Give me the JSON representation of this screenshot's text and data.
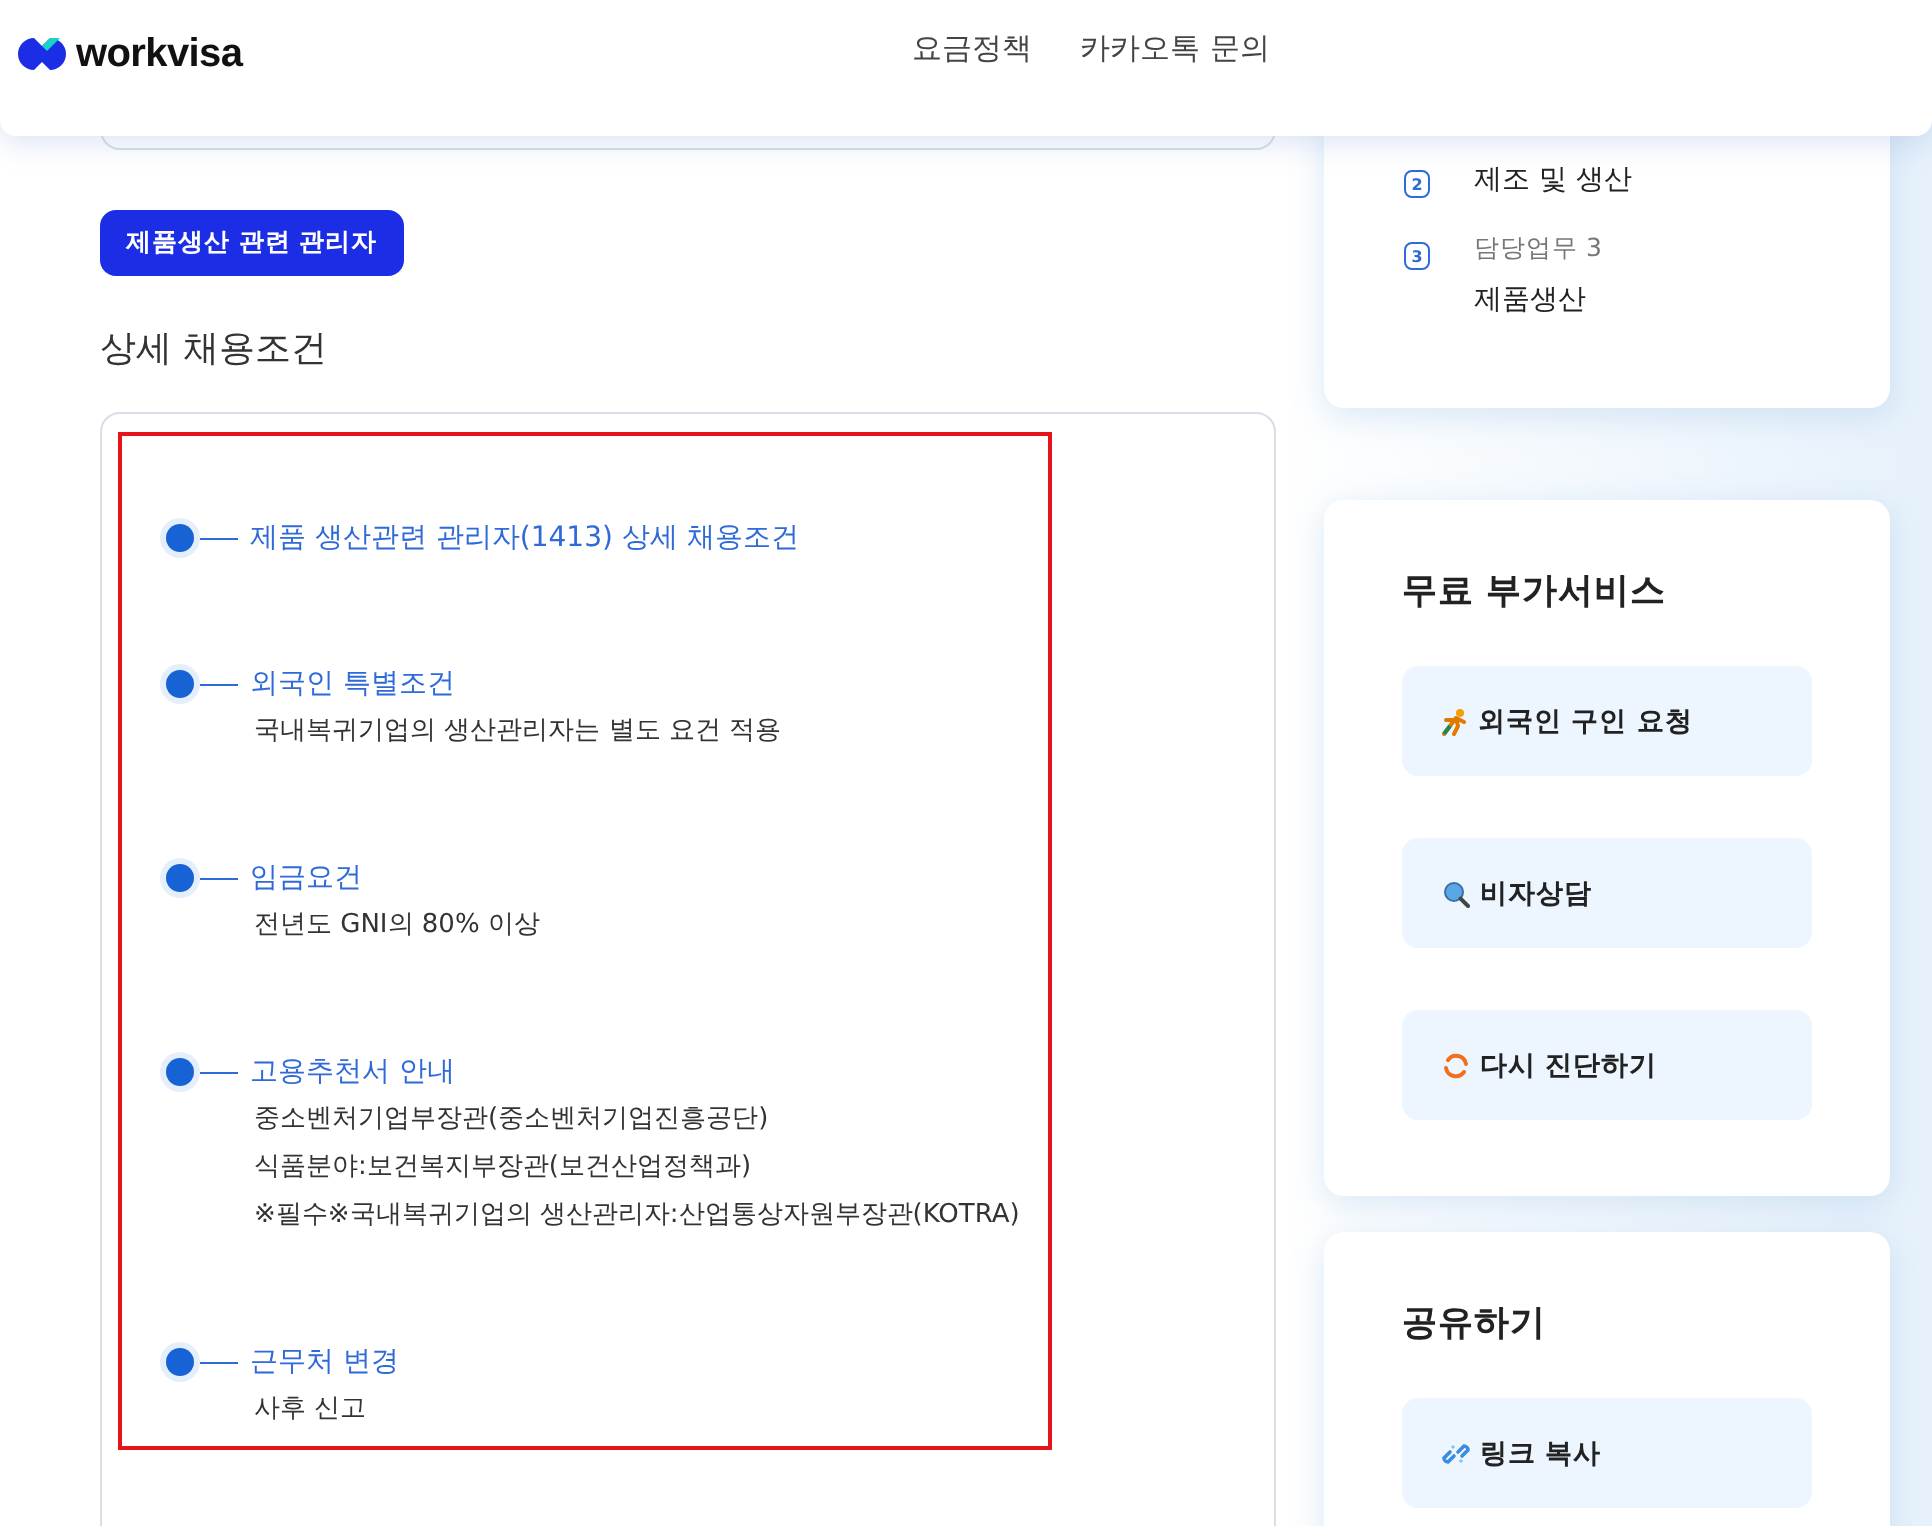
{
  "header": {
    "logo": "workvisa",
    "nav": [
      "요금정책",
      "카카오톡 문의"
    ]
  },
  "job_tag": "제품생산 관련 관리자",
  "section_title": "상세 채용조건",
  "conditions": [
    {
      "title": "제품 생산관련 관리자(1413) 상세 채용조건"
    },
    {
      "title": "외국인 특별조건",
      "lines": [
        "국내복귀기업의 생산관리자는 별도 요건 적용"
      ]
    },
    {
      "title": "임금요건",
      "lines": [
        "전년도 GNI의 80% 이상"
      ]
    },
    {
      "title": "고용추천서 안내",
      "lines": [
        "중소벤처기업부장관(중소벤처기업진흥공단)",
        "식품분야:보건복지부장관(보건산업정책과)",
        "※필수※국내복귀기업의 생산관리자:산업통상자원부장관(KOTRA)"
      ]
    },
    {
      "title": "근무처 변경",
      "lines": [
        "사후 신고"
      ]
    }
  ],
  "duties": [
    {
      "number": "2",
      "value": "제조 및 생산"
    },
    {
      "number": "3",
      "label": "담당업무 3",
      "value": "제품생산"
    }
  ],
  "free_services": {
    "title": "무료 부가서비스",
    "buttons": [
      {
        "kind": "runner",
        "label": "외국인 구인 요청"
      },
      {
        "kind": "search",
        "label": "비자상담"
      },
      {
        "kind": "refresh",
        "label": "다시 진단하기"
      }
    ]
  },
  "share": {
    "title": "공유하기",
    "buttons": [
      {
        "kind": "link",
        "label": "링크 복사"
      }
    ]
  }
}
